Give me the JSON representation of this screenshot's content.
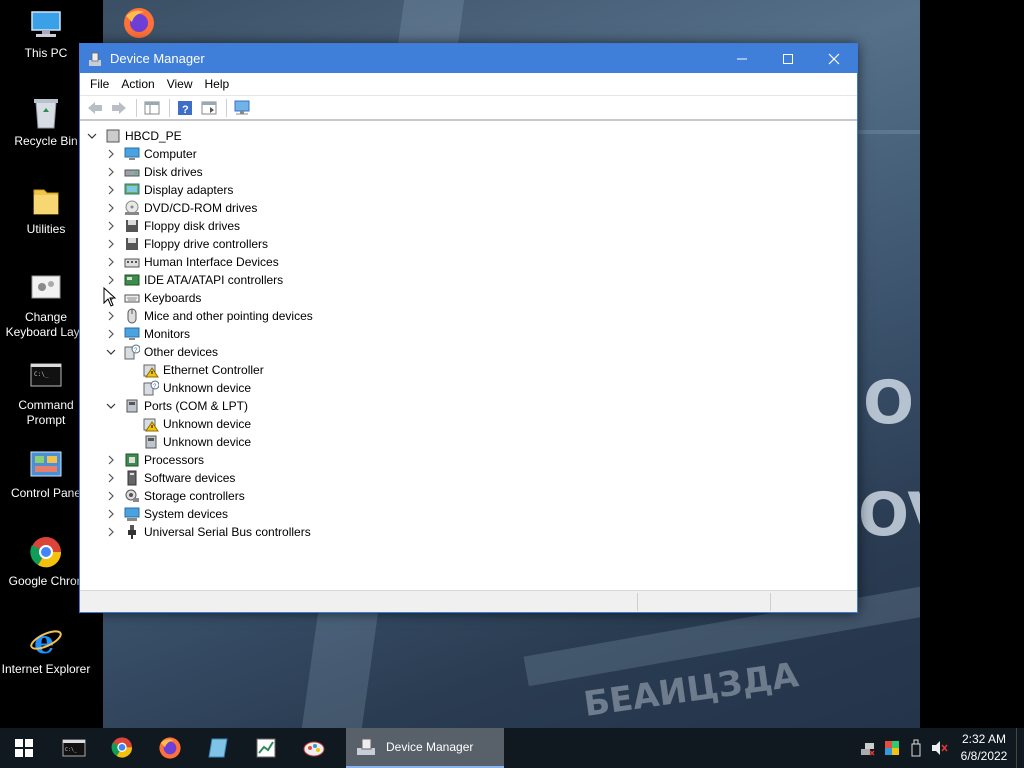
{
  "desktop": {
    "icons": [
      {
        "label": "This PC",
        "icon": "computer-icon"
      },
      {
        "label": "Recycle Bin",
        "icon": "recycle-bin-icon"
      },
      {
        "label": "Utilities",
        "icon": "folder-icon"
      },
      {
        "label": "Change Keyboard Layo",
        "icon": "keyboard-settings-icon"
      },
      {
        "label": "Command Prompt",
        "icon": "terminal-icon"
      },
      {
        "label": "Control Pane",
        "icon": "control-panel-icon"
      },
      {
        "label": "Google Chron",
        "icon": "chrome-icon"
      },
      {
        "label": "Internet Explorer",
        "icon": "ie-icon"
      }
    ],
    "wallpaper_text": [
      "O",
      "OV",
      "БЕАИЦЗДА"
    ]
  },
  "window": {
    "title": "Device Manager",
    "menu": [
      "File",
      "Action",
      "View",
      "Help"
    ],
    "tree": {
      "root": "HBCD_PE",
      "categories": [
        {
          "label": "Computer",
          "icon": "monitor-icon",
          "expanded": false
        },
        {
          "label": "Disk drives",
          "icon": "disk-drive-icon",
          "expanded": false
        },
        {
          "label": "Display adapters",
          "icon": "display-adapter-icon",
          "expanded": false
        },
        {
          "label": "DVD/CD-ROM drives",
          "icon": "dvd-drive-icon",
          "expanded": false
        },
        {
          "label": "Floppy disk drives",
          "icon": "floppy-icon",
          "expanded": false
        },
        {
          "label": "Floppy drive controllers",
          "icon": "floppy-controller-icon",
          "expanded": false
        },
        {
          "label": "Human Interface Devices",
          "icon": "hid-icon",
          "expanded": false
        },
        {
          "label": "IDE ATA/ATAPI controllers",
          "icon": "ide-controller-icon",
          "expanded": false
        },
        {
          "label": "Keyboards",
          "icon": "keyboard-icon",
          "expanded": false
        },
        {
          "label": "Mice and other pointing devices",
          "icon": "mouse-icon",
          "expanded": false
        },
        {
          "label": "Monitors",
          "icon": "monitor-icon",
          "expanded": false
        },
        {
          "label": "Other devices",
          "icon": "unknown-device-icon",
          "expanded": true,
          "children": [
            {
              "label": "Ethernet Controller",
              "icon": "warning-device-icon"
            },
            {
              "label": "Unknown device",
              "icon": "unknown-device-icon"
            }
          ]
        },
        {
          "label": "Ports (COM & LPT)",
          "icon": "port-icon",
          "expanded": true,
          "children": [
            {
              "label": "Unknown device",
              "icon": "warning-device-icon"
            },
            {
              "label": "Unknown device",
              "icon": "port-icon"
            }
          ]
        },
        {
          "label": "Processors",
          "icon": "processor-icon",
          "expanded": false
        },
        {
          "label": "Software devices",
          "icon": "software-device-icon",
          "expanded": false
        },
        {
          "label": "Storage controllers",
          "icon": "storage-controller-icon",
          "expanded": false
        },
        {
          "label": "System devices",
          "icon": "system-device-icon",
          "expanded": false
        },
        {
          "label": "Universal Serial Bus controllers",
          "icon": "usb-icon",
          "expanded": false
        }
      ]
    }
  },
  "taskbar": {
    "active_app": "Device Manager",
    "pinned": [
      "terminal-icon",
      "chrome-icon",
      "firefox-icon",
      "notepad-icon",
      "chart-icon",
      "paint-icon"
    ],
    "clock_time": "2:32 AM",
    "clock_date": "6/8/2022"
  },
  "colors": {
    "titlebar": "#3f7ed9",
    "taskbar": "#101820",
    "accent": "#8ab4f0"
  }
}
